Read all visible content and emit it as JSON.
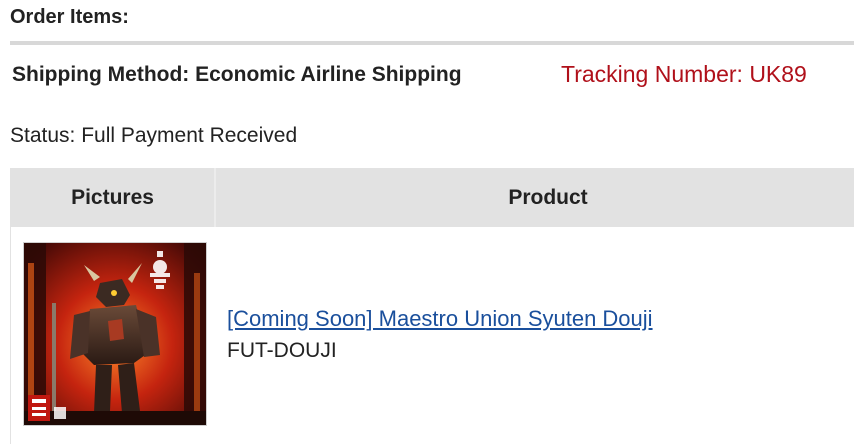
{
  "order": {
    "section_title": "Order Items:",
    "shipping_method": "Shipping Method: Economic Airline Shipping",
    "tracking_number": "Tracking Number: UK89",
    "status": "Status: Full Payment Received"
  },
  "table": {
    "headers": [
      "Pictures",
      "Product"
    ],
    "rows": [
      {
        "picture_icon": "product-photo",
        "product_name": "[Coming Soon] Maestro Union Syuten Douji",
        "sku": "FUT-DOUJI"
      }
    ]
  },
  "colors": {
    "tracking": "#b0101a",
    "link": "#1a4f9c",
    "header_bg": "#e2e2e2"
  }
}
